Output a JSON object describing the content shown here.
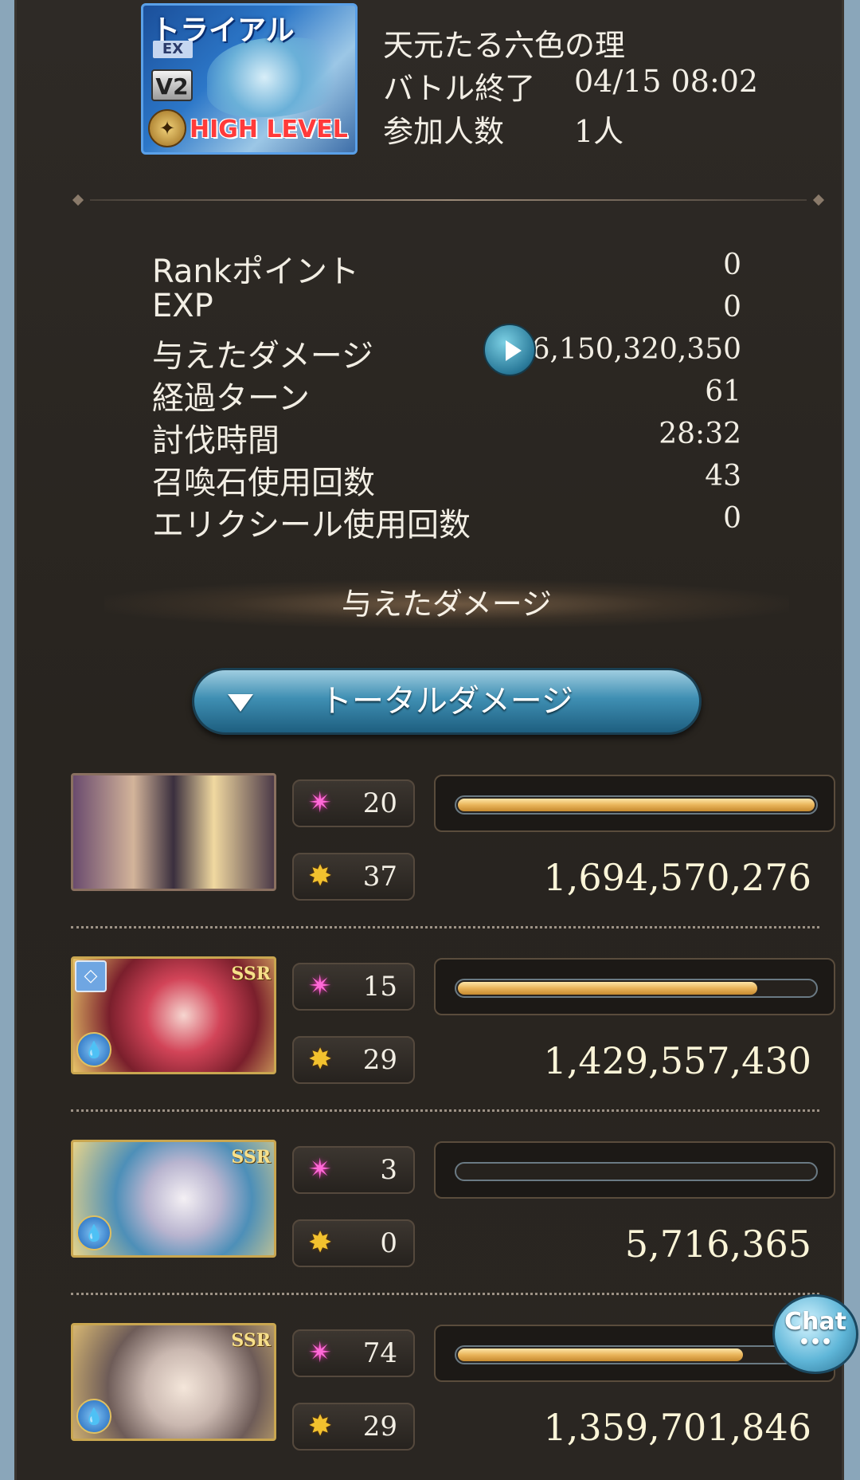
{
  "quest": {
    "banner_trial": "トライアル",
    "banner_ex": "EX",
    "banner_v2": "V2",
    "banner_high_level": "HIGH LEVEL",
    "name": "天元たる六色の理",
    "battle_end_label": "バトル終了",
    "battle_end_value": "04/15 08:02",
    "participants_label": "参加人数",
    "participants_value": "1人"
  },
  "stats": [
    {
      "label": "Rankポイント",
      "value": "0"
    },
    {
      "label": "EXP",
      "value": "0"
    },
    {
      "label": "与えたダメージ",
      "value": "6,150,320,350"
    },
    {
      "label": "経過ターン",
      "value": "61"
    },
    {
      "label": "討伐時間",
      "value": "28:32"
    },
    {
      "label": "召喚石使用回数",
      "value": "43"
    },
    {
      "label": "エリクシール使用回数",
      "value": "0"
    }
  ],
  "section_title": "与えたダメージ",
  "dropdown": {
    "label": "トータルダメージ"
  },
  "characters": [
    {
      "skill_count": "20",
      "ca_count": "37",
      "damage": "1,694,570,276",
      "bar_fraction": 1.0,
      "rarity": ""
    },
    {
      "skill_count": "15",
      "ca_count": "29",
      "damage": "1,429,557,430",
      "bar_fraction": 0.84,
      "rarity": "SSR"
    },
    {
      "skill_count": "3",
      "ca_count": "0",
      "damage": "5,716,365",
      "bar_fraction": 0.0,
      "rarity": "SSR"
    },
    {
      "skill_count": "74",
      "ca_count": "29",
      "damage": "1,359,701,846",
      "bar_fraction": 0.8,
      "rarity": "SSR"
    }
  ],
  "chat_button": {
    "label": "Chat",
    "dots": "•••"
  },
  "icons": {
    "play": "play-icon",
    "skill": "star-burst-icon",
    "charge_attack": "charge-attack-icon",
    "element": "water-element-icon",
    "ring": "ring-icon"
  },
  "colors": {
    "bar_fill": "#e9b45a",
    "skill_icon": "#ff6ad8",
    "ca_icon": "#f2c12e"
  }
}
